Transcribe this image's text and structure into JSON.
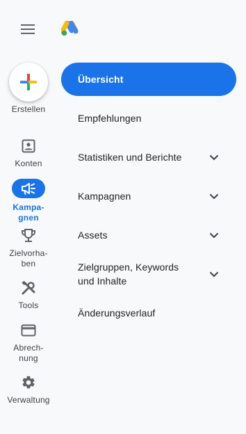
{
  "header": {
    "menu_icon": "hamburger-menu-icon",
    "logo_icon": "google-ads-logo"
  },
  "rail": {
    "items": [
      {
        "label": "Erstellen",
        "icon": "plus-icon"
      },
      {
        "label": "Konten",
        "icon": "account-box-icon"
      },
      {
        "label": "Kampa-\ngnen",
        "icon": "campaign-megaphone-icon",
        "active": true
      },
      {
        "label": "Zielvorha-\nben",
        "icon": "trophy-icon"
      },
      {
        "label": "Tools",
        "icon": "tools-icon"
      },
      {
        "label": "Abrech-\nnung",
        "icon": "credit-card-icon"
      },
      {
        "label": "Verwaltung",
        "icon": "gear-icon"
      }
    ]
  },
  "nav": {
    "items": [
      {
        "label": "Übersicht",
        "active": true,
        "expandable": false
      },
      {
        "label": "Empfehlungen",
        "expandable": false
      },
      {
        "label": "Statistiken und Berichte",
        "expandable": true
      },
      {
        "label": "Kampagnen",
        "expandable": true
      },
      {
        "label": "Assets",
        "expandable": true
      },
      {
        "label": "Zielgruppen, Keywords und Inhalte",
        "expandable": true
      },
      {
        "label": "Änderungsverlauf",
        "expandable": false
      }
    ]
  },
  "colors": {
    "accent": "#1a73e8",
    "background": "#f8f9fa",
    "text": "#202124",
    "icon": "#5f6368"
  }
}
